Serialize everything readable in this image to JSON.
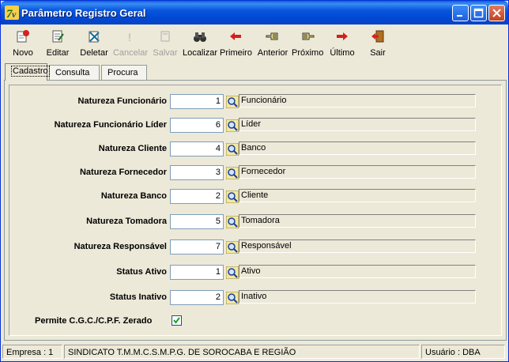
{
  "window": {
    "title": "Parâmetro Registro Geral"
  },
  "titlebar_buttons": [
    "minimize-button",
    "maximize-button",
    "close-button"
  ],
  "toolbar": {
    "items": [
      {
        "label": "Novo",
        "icon": "new-record-icon",
        "enabled": true
      },
      {
        "label": "Editar",
        "icon": "edit-icon",
        "enabled": true
      },
      {
        "label": "Deletar",
        "icon": "delete-icon",
        "enabled": true
      },
      {
        "label": "Cancelar",
        "icon": "cancel-icon",
        "enabled": false
      },
      {
        "label": "Salvar",
        "icon": "save-icon",
        "enabled": false
      },
      {
        "label": "Localizar",
        "icon": "binoculars-icon",
        "enabled": true
      },
      {
        "label": "Primeiro",
        "icon": "first-arrow-icon",
        "enabled": true
      },
      {
        "label": "Anterior",
        "icon": "previous-hand-icon",
        "enabled": true
      },
      {
        "label": "Próximo",
        "icon": "next-hand-icon",
        "enabled": true
      },
      {
        "label": "Último",
        "icon": "last-arrow-icon",
        "enabled": true
      },
      {
        "label": "Sair",
        "icon": "exit-door-icon",
        "enabled": true
      }
    ]
  },
  "tabs": [
    "Cadastro",
    "Consulta",
    "Procura"
  ],
  "active_tab": "Cadastro",
  "form": {
    "rows": [
      {
        "label": "Natureza Funcionário",
        "value": "1",
        "description": "Funcionário"
      },
      {
        "label": "Natureza Funcionário Líder",
        "value": "6",
        "description": "Líder"
      },
      {
        "label": "Natureza Cliente",
        "value": "4",
        "description": "Banco"
      },
      {
        "label": "Natureza Fornecedor",
        "value": "3",
        "description": "Fornecedor"
      },
      {
        "label": "Natureza Banco",
        "value": "2",
        "description": "Cliente"
      },
      {
        "label": "Natureza Tomadora",
        "value": "5",
        "description": "Tomadora"
      },
      {
        "label": "Natureza Responsável",
        "value": "7",
        "description": "Responsável"
      },
      {
        "label": "Status Ativo",
        "value": "1",
        "description": "Ativo"
      },
      {
        "label": "Status Inativo",
        "value": "2",
        "description": "Inativo"
      }
    ],
    "checkbox": {
      "label": "Permite C.G.C./C.P.F. Zerado",
      "checked": true
    }
  },
  "statusbar": {
    "empresa": "Empresa : 1",
    "company_name": "SINDICATO T.M.M.C.S.M.P.G. DE SOROCABA E REGIÃO",
    "usuario": "Usuário : DBA"
  },
  "colors": {
    "title_bar": "#0054E3",
    "window_bg": "#ECE9D8",
    "arrow_red": "#D42020"
  }
}
